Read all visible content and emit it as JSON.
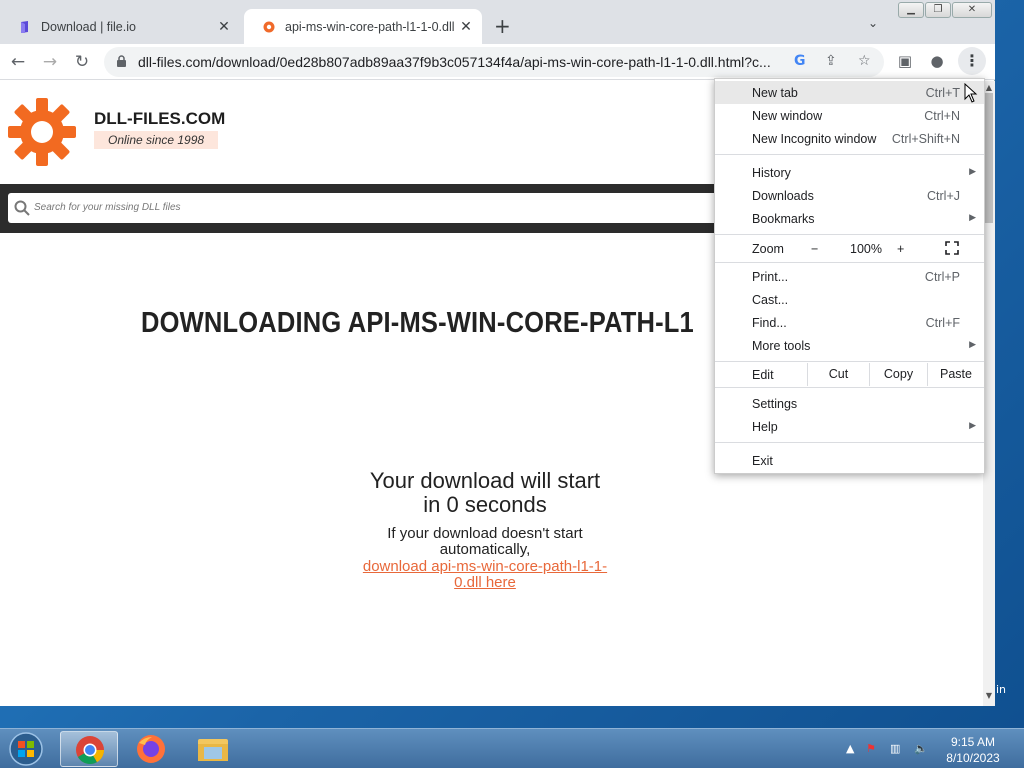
{
  "tabs": [
    {
      "title": "Download | file.io",
      "active": false
    },
    {
      "title": "api-ms-win-core-path-l1-1-0.dll",
      "active": true
    }
  ],
  "address_bar": {
    "url": "dll-files.com/download/0ed28b807adb89aa37f9b3c057134f4a/api-ms-win-core-path-l1-1-0.dll.html?c..."
  },
  "site": {
    "brand": "DLL-FILES.COM",
    "tagline": "Online since 1998",
    "search_placeholder": "Search for your missing DLL files",
    "heading": "DOWNLOADING API-MS-WIN-CORE-PATH-L1",
    "download_start_line1": "Your download will start",
    "download_start_line2": "in 0 seconds",
    "note_line1": "If your download doesn't start",
    "note_line2": "automatically,",
    "link_line1": "download api-ms-win-core-path-l1-1-",
    "link_line2": "0.dll here"
  },
  "menu": {
    "new_tab": {
      "label": "New tab",
      "shortcut": "Ctrl+T"
    },
    "new_window": {
      "label": "New window",
      "shortcut": "Ctrl+N"
    },
    "new_incognito": {
      "label": "New Incognito window",
      "shortcut": "Ctrl+Shift+N"
    },
    "history": {
      "label": "History"
    },
    "downloads": {
      "label": "Downloads",
      "shortcut": "Ctrl+J"
    },
    "bookmarks": {
      "label": "Bookmarks"
    },
    "zoom": {
      "label": "Zoom",
      "minus": "−",
      "value": "100%",
      "plus": "+"
    },
    "print": {
      "label": "Print...",
      "shortcut": "Ctrl+P"
    },
    "cast": {
      "label": "Cast..."
    },
    "find": {
      "label": "Find...",
      "shortcut": "Ctrl+F"
    },
    "more_tools": {
      "label": "More tools"
    },
    "edit": {
      "label": "Edit",
      "cut": "Cut",
      "copy": "Copy",
      "paste": "Paste"
    },
    "settings": {
      "label": "Settings"
    },
    "help": {
      "label": "Help"
    },
    "exit": {
      "label": "Exit"
    }
  },
  "desktop": {
    "text": "in"
  },
  "taskbar": {
    "time": "9:15 AM",
    "date": "8/10/2023"
  }
}
